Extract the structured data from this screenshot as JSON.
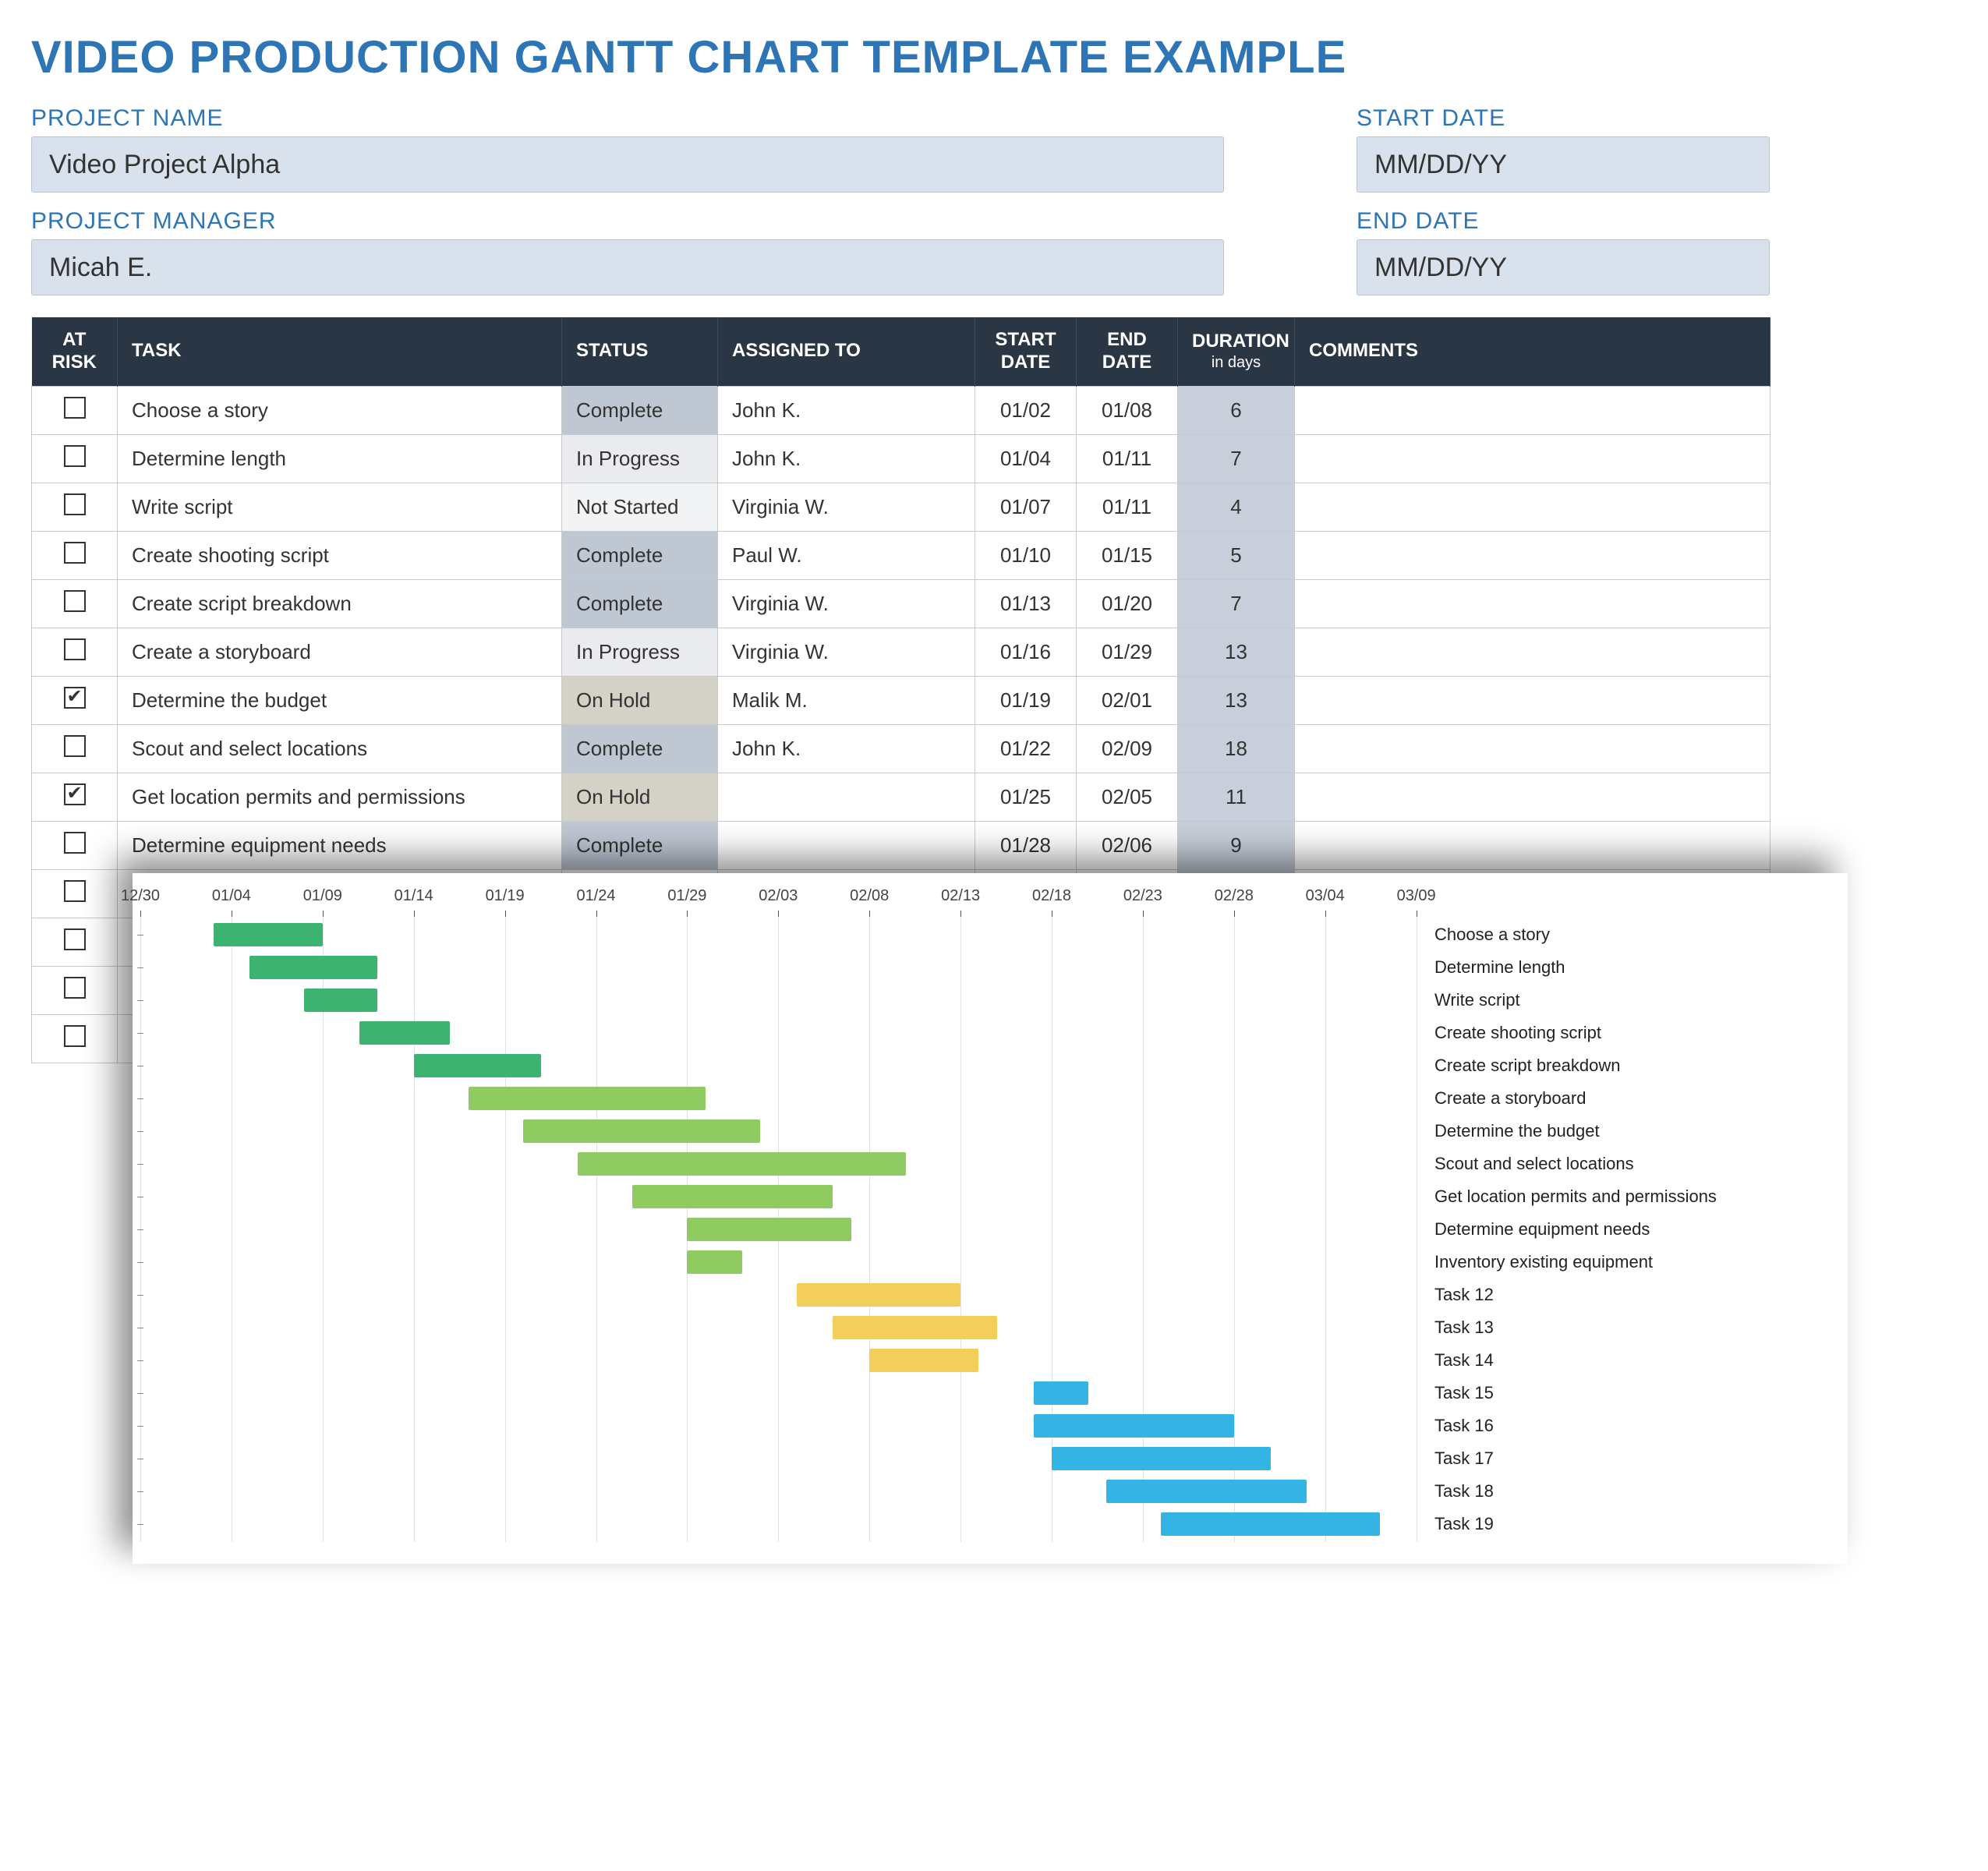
{
  "title": "VIDEO PRODUCTION GANTT CHART TEMPLATE EXAMPLE",
  "meta": {
    "project_name_label": "PROJECT NAME",
    "project_name_value": "Video Project Alpha",
    "project_manager_label": "PROJECT MANAGER",
    "project_manager_value": "Micah E.",
    "start_date_label": "START DATE",
    "start_date_value": "MM/DD/YY",
    "end_date_label": "END DATE",
    "end_date_value": "MM/DD/YY"
  },
  "headers": {
    "at_risk": "AT RISK",
    "task": "TASK",
    "status": "STATUS",
    "assigned": "ASSIGNED TO",
    "start": "START DATE",
    "end": "END DATE",
    "duration": "DURATION",
    "duration_sub": "in days",
    "comments": "COMMENTS"
  },
  "status_colors": {
    "Complete": "#BFC7D3",
    "In Progress": "#E9EBEF",
    "Not Started": "#F2F3F5",
    "On Hold": "#D4D1C6"
  },
  "tasks": [
    {
      "at_risk": false,
      "task": "Choose a story",
      "status": "Complete",
      "assigned": "John K.",
      "start": "01/02",
      "end": "01/08",
      "duration": "6",
      "comments": ""
    },
    {
      "at_risk": false,
      "task": "Determine length",
      "status": "In Progress",
      "assigned": "John K.",
      "start": "01/04",
      "end": "01/11",
      "duration": "7",
      "comments": ""
    },
    {
      "at_risk": false,
      "task": "Write script",
      "status": "Not Started",
      "assigned": "Virginia W.",
      "start": "01/07",
      "end": "01/11",
      "duration": "4",
      "comments": ""
    },
    {
      "at_risk": false,
      "task": "Create shooting script",
      "status": "Complete",
      "assigned": "Paul W.",
      "start": "01/10",
      "end": "01/15",
      "duration": "5",
      "comments": ""
    },
    {
      "at_risk": false,
      "task": "Create script breakdown",
      "status": "Complete",
      "assigned": "Virginia W.",
      "start": "01/13",
      "end": "01/20",
      "duration": "7",
      "comments": ""
    },
    {
      "at_risk": false,
      "task": "Create a storyboard",
      "status": "In Progress",
      "assigned": "Virginia W.",
      "start": "01/16",
      "end": "01/29",
      "duration": "13",
      "comments": ""
    },
    {
      "at_risk": true,
      "task": "Determine the budget",
      "status": "On Hold",
      "assigned": "Malik M.",
      "start": "01/19",
      "end": "02/01",
      "duration": "13",
      "comments": ""
    },
    {
      "at_risk": false,
      "task": "Scout and select locations",
      "status": "Complete",
      "assigned": "John K.",
      "start": "01/22",
      "end": "02/09",
      "duration": "18",
      "comments": ""
    },
    {
      "at_risk": true,
      "task": "Get location permits and permissions",
      "status": "On Hold",
      "assigned": "",
      "start": "01/25",
      "end": "02/05",
      "duration": "11",
      "comments": ""
    },
    {
      "at_risk": false,
      "task": "Determine equipment needs",
      "status": "Complete",
      "assigned": "",
      "start": "01/28",
      "end": "02/06",
      "duration": "9",
      "comments": ""
    },
    {
      "at_risk": false,
      "task": "",
      "status": "",
      "assigned": "",
      "start": "",
      "end": "",
      "duration": "",
      "comments": ""
    },
    {
      "at_risk": false,
      "task": "",
      "status": "",
      "assigned": "",
      "start": "",
      "end": "",
      "duration": "",
      "comments": ""
    },
    {
      "at_risk": false,
      "task": "",
      "status": "",
      "assigned": "",
      "start": "",
      "end": "",
      "duration": "",
      "comments": ""
    },
    {
      "at_risk": false,
      "task": "",
      "status": "",
      "assigned": "",
      "start": "",
      "end": "",
      "duration": "",
      "comments": ""
    }
  ],
  "chart_data": {
    "type": "bar",
    "x_axis_ticks": [
      "12/30",
      "01/04",
      "01/09",
      "01/14",
      "01/19",
      "01/24",
      "01/29",
      "02/03",
      "02/08",
      "02/13",
      "02/18",
      "02/23",
      "02/28",
      "03/04",
      "03/09"
    ],
    "x_range_days": [
      -3,
      68
    ],
    "color_groups": {
      "group1": "#3CB371",
      "group2": "#8FCB61",
      "group3": "#F2CF5B",
      "group4": "#34B4E4"
    },
    "series": [
      {
        "label": "Choose a story",
        "start_day": 1,
        "duration": 6,
        "color": "group1"
      },
      {
        "label": "Determine length",
        "start_day": 3,
        "duration": 7,
        "color": "group1"
      },
      {
        "label": "Write script",
        "start_day": 6,
        "duration": 4,
        "color": "group1"
      },
      {
        "label": "Create shooting script",
        "start_day": 9,
        "duration": 5,
        "color": "group1"
      },
      {
        "label": "Create script breakdown",
        "start_day": 12,
        "duration": 7,
        "color": "group1"
      },
      {
        "label": "Create a storyboard",
        "start_day": 15,
        "duration": 13,
        "color": "group2"
      },
      {
        "label": "Determine the budget",
        "start_day": 18,
        "duration": 13,
        "color": "group2"
      },
      {
        "label": "Scout and select locations",
        "start_day": 21,
        "duration": 18,
        "color": "group2"
      },
      {
        "label": "Get location permits and permissions",
        "start_day": 24,
        "duration": 11,
        "color": "group2"
      },
      {
        "label": "Determine equipment needs",
        "start_day": 27,
        "duration": 9,
        "color": "group2"
      },
      {
        "label": "Inventory existing equipment",
        "start_day": 27,
        "duration": 3,
        "color": "group2"
      },
      {
        "label": "Task 12",
        "start_day": 33,
        "duration": 9,
        "color": "group3"
      },
      {
        "label": "Task 13",
        "start_day": 35,
        "duration": 9,
        "color": "group3"
      },
      {
        "label": "Task 14",
        "start_day": 37,
        "duration": 6,
        "color": "group3"
      },
      {
        "label": "Task 15",
        "start_day": 46,
        "duration": 3,
        "color": "group4"
      },
      {
        "label": "Task 16",
        "start_day": 46,
        "duration": 11,
        "color": "group4"
      },
      {
        "label": "Task 17",
        "start_day": 47,
        "duration": 12,
        "color": "group4"
      },
      {
        "label": "Task 18",
        "start_day": 50,
        "duration": 11,
        "color": "group4"
      },
      {
        "label": "Task 19",
        "start_day": 53,
        "duration": 12,
        "color": "group4"
      }
    ]
  }
}
